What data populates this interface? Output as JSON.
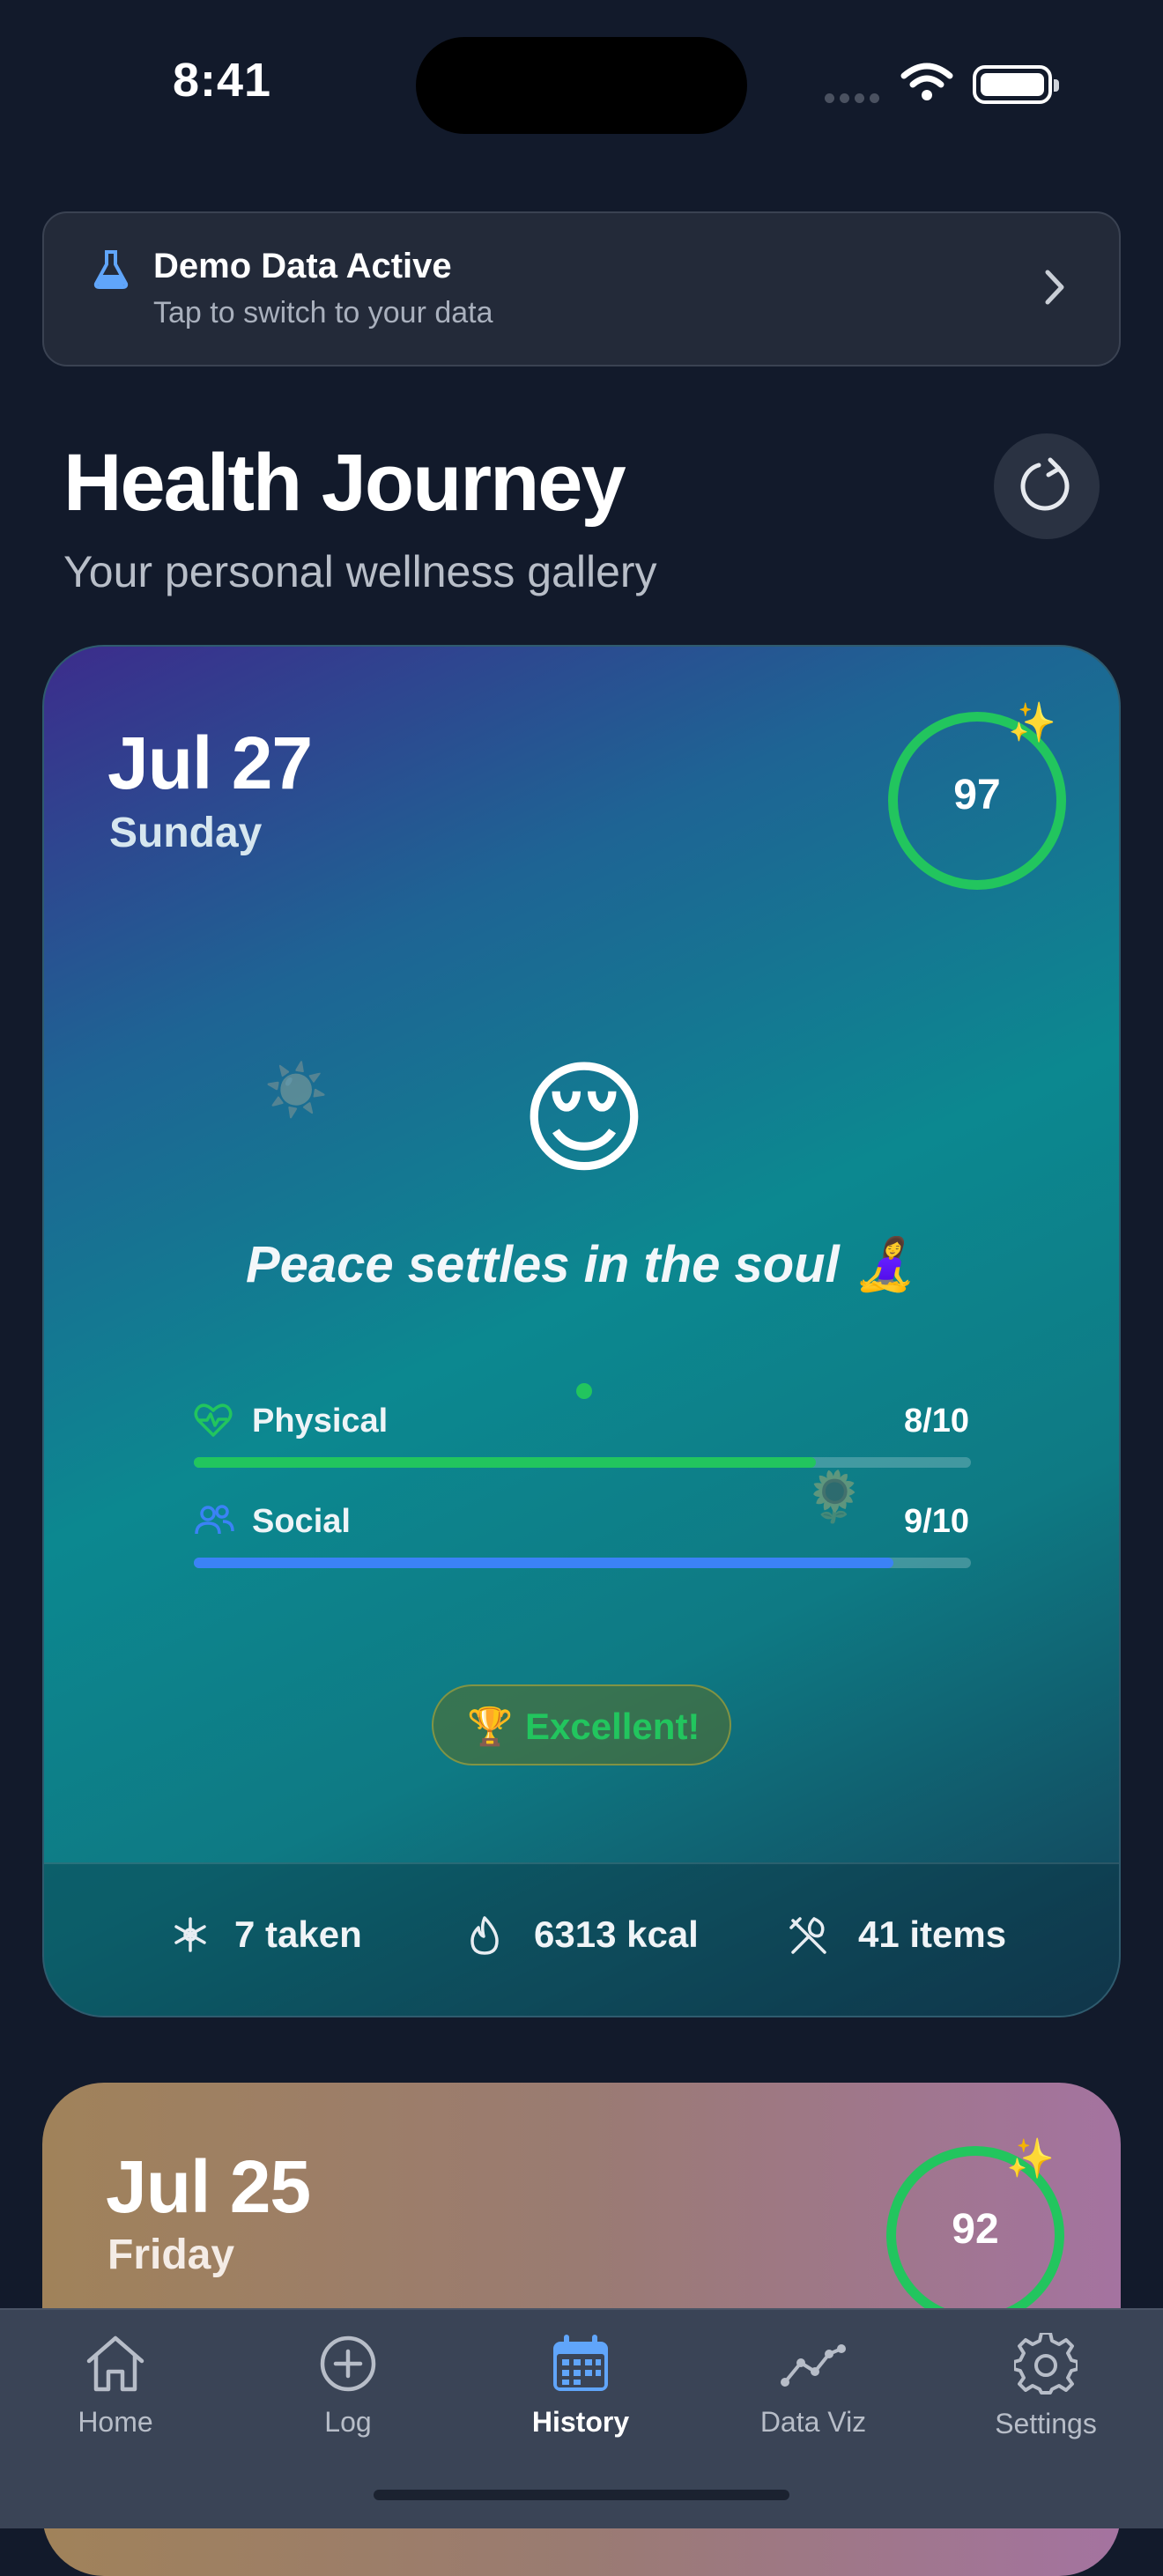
{
  "status": {
    "time": "8:41"
  },
  "banner": {
    "title": "Demo Data Active",
    "subtitle": "Tap to switch to your data",
    "icon": "flask-icon",
    "accent": "#60a5fa"
  },
  "header": {
    "title": "Health Journey",
    "subtitle": "Your personal wellness gallery"
  },
  "entries": [
    {
      "date": "Jul 27",
      "day": "Sunday",
      "score": "97",
      "score_color": "#22c55e",
      "sparkle": "✨",
      "mood_emoji": "😌",
      "decor_sun": "☀️",
      "decor_flower": "🌻",
      "quote": "Peace settles in the soul 🧘‍♀️",
      "metrics": [
        {
          "label": "Physical",
          "value": "8/10",
          "level": 0.8,
          "color": "#22c55e",
          "icon": "heart-pulse-icon"
        },
        {
          "label": "Social",
          "value": "9/10",
          "level": 0.9,
          "color": "#3b82f6",
          "icon": "people-icon"
        }
      ],
      "badge": {
        "icon": "🏆",
        "label": "Excellent!"
      },
      "stats": [
        {
          "icon": "pill-icon",
          "label": "7 taken"
        },
        {
          "icon": "flame-icon",
          "label": "6313 kcal"
        },
        {
          "icon": "utensils-icon",
          "label": "41 items"
        }
      ]
    },
    {
      "date": "Jul 25",
      "day": "Friday",
      "score": "92",
      "score_color": "#22c55e",
      "sparkle": "✨"
    }
  ],
  "tabs": [
    {
      "label": "Home",
      "icon": "home-icon"
    },
    {
      "label": "Log",
      "icon": "plus-circle-icon"
    },
    {
      "label": "History",
      "icon": "calendar-icon",
      "active": true,
      "color": "#60a5fa"
    },
    {
      "label": "Data Viz",
      "icon": "chart-line-icon"
    },
    {
      "label": "Settings",
      "icon": "gear-icon"
    }
  ]
}
